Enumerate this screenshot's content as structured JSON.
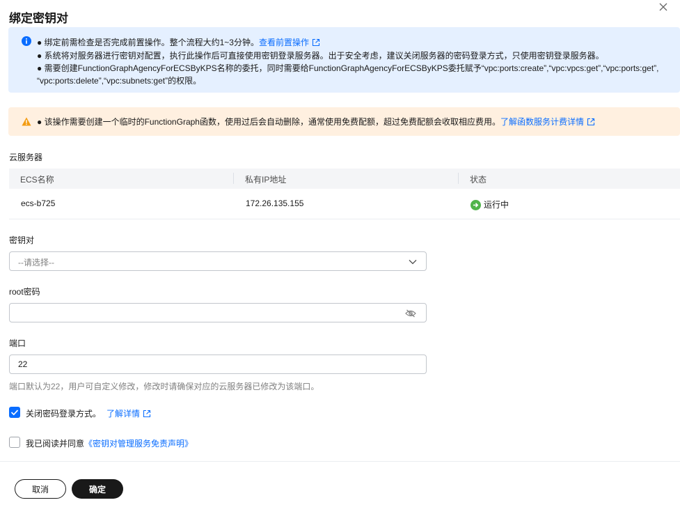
{
  "dialog": {
    "title": "绑定密钥对"
  },
  "info_banner": {
    "line1_text": "● 绑定前需检查是否完成前置操作。整个流程大约1~3分钟。",
    "line1_link": "查看前置操作",
    "line2_text": "● 系统将对服务器进行密钥对配置，执行此操作后可直接使用密钥登录服务器。出于安全考虑，建议关闭服务器的密码登录方式，只使用密钥登录服务器。",
    "line3_text": "● 需要创建FunctionGraphAgencyForECSByKPS名称的委托，同时需要给FunctionGraphAgencyForECSByKPS委托赋予“vpc:ports:create”,“vpc:vpcs:get”,“vpc:ports:get”,",
    "line4_text": "“vpc:ports:delete”,“vpc:subnets:get”的权限。"
  },
  "warn_banner": {
    "text": "● 该操作需要创建一个临时的FunctionGraph函数，使用过后会自动删除，通常使用免费配额，超过免费配额会收取相应费用。",
    "link": "了解函数服务计费详情"
  },
  "servers": {
    "label": "云服务器",
    "columns": [
      "ECS名称",
      "私有IP地址",
      "状态"
    ],
    "rows": [
      {
        "name": "ecs-b725",
        "ip": "172.26.135.155",
        "status": "运行中"
      }
    ]
  },
  "keypair": {
    "label": "密钥对",
    "placeholder": "--请选择--"
  },
  "root_password": {
    "label": "root密码",
    "value": ""
  },
  "port": {
    "label": "端口",
    "value": "22",
    "hint": "端口默认为22，用户可自定义修改，修改时请确保对应的云服务器已修改为该端口。"
  },
  "disable_password": {
    "checked": true,
    "label": "关闭密码登录方式。",
    "link": "了解详情"
  },
  "agreement": {
    "checked": false,
    "label": "我已阅读并同意",
    "link": "《密钥对管理服务免责声明》"
  },
  "buttons": {
    "cancel": "取消",
    "confirm": "确定"
  },
  "colors": {
    "accent": "#0a6dff",
    "info_bg": "#e5f0ff",
    "warn_bg": "#fff0e0",
    "warn_icon": "#f39c12",
    "status_running": "#50b44a",
    "primary_button": "#191919"
  }
}
